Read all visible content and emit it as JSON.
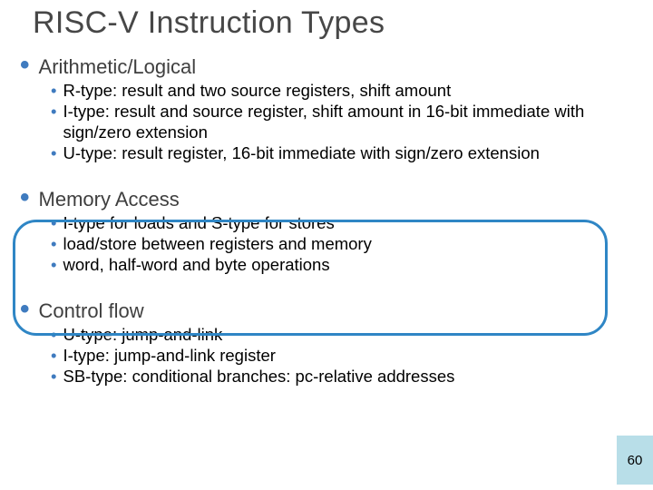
{
  "title": "RISC-V Instruction Types",
  "sections": [
    {
      "label": "Arithmetic/Logical",
      "items": [
        "R-type: result and two source registers, shift amount",
        "I-type: result and source register, shift amount in 16-bit immediate with sign/zero extension",
        "U-type: result register, 16-bit immediate with sign/zero extension"
      ]
    },
    {
      "label": "Memory Access",
      "items": [
        "I-type for loads and S-type for stores",
        "load/store between registers and memory",
        "word, half-word and byte operations"
      ]
    },
    {
      "label": "Control flow",
      "items": [
        "U-type: jump-and-link",
        "I-type: jump-and-link register",
        "SB-type: conditional branches: pc-relative addresses"
      ]
    }
  ],
  "highlight_index": 1,
  "slide_number": "60",
  "colors": {
    "accent": "#3f7bbf",
    "highlight": "#2f86c5",
    "bar": "#b8dee8"
  }
}
